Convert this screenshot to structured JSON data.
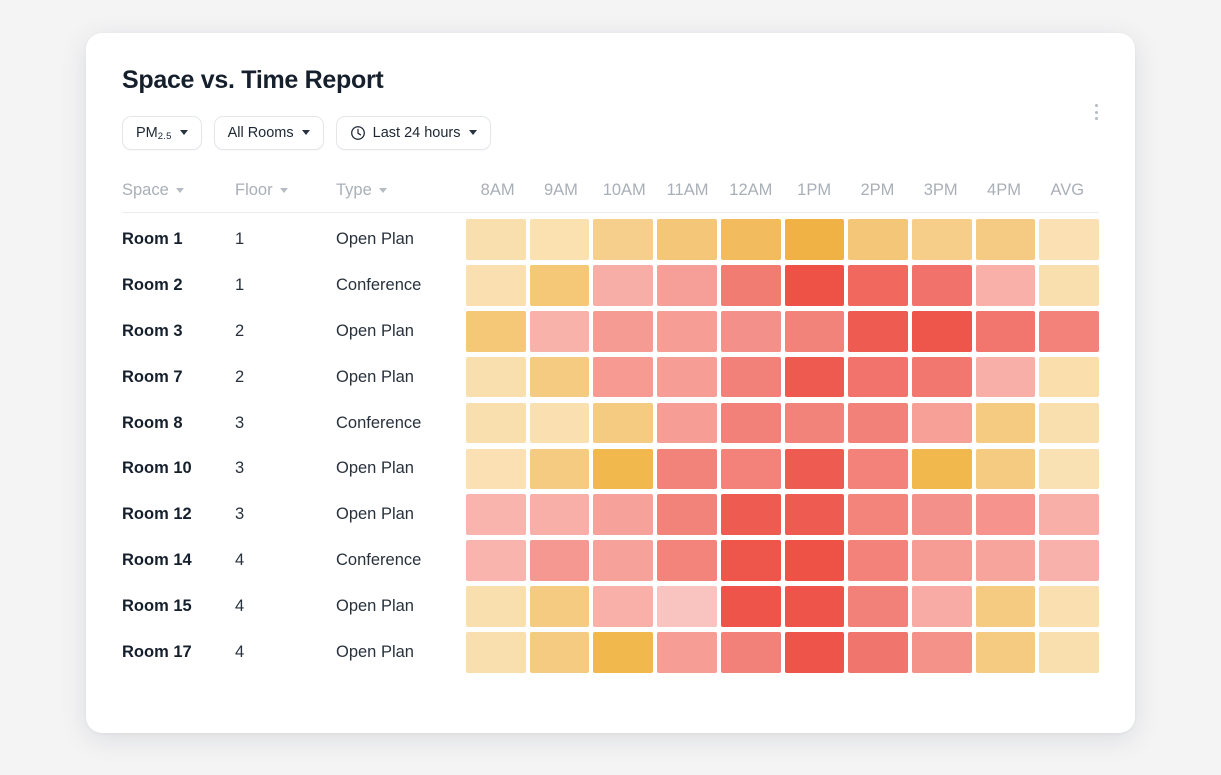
{
  "card": {
    "title": "Space vs. Time Report",
    "menu_icon": "kebab-vertical-icon"
  },
  "filters": [
    {
      "id": "pollutant",
      "label_main": "PM",
      "label_sub": "2.5",
      "caret": true
    },
    {
      "id": "rooms",
      "label_main": "All Rooms",
      "label_sub": "",
      "caret": true
    },
    {
      "id": "timerange",
      "icon": "clock-icon",
      "label_main": "Last 24 hours",
      "label_sub": "",
      "caret": true
    }
  ],
  "table": {
    "columns": [
      {
        "key": "space",
        "label": "Space",
        "sortable": true
      },
      {
        "key": "floor",
        "label": "Floor",
        "sortable": true
      },
      {
        "key": "type",
        "label": "Type",
        "sortable": true
      }
    ],
    "time_headers": [
      "8AM",
      "9AM",
      "10AM",
      "11AM",
      "12AM",
      "1PM",
      "2PM",
      "3PM",
      "4PM",
      "AVG"
    ]
  },
  "chart_data": {
    "type": "heatmap",
    "title": "Space vs. Time Report",
    "xlabel": "",
    "ylabel": "",
    "x_categories": [
      "8AM",
      "9AM",
      "10AM",
      "11AM",
      "12AM",
      "1PM",
      "2PM",
      "3PM",
      "4PM",
      "AVG"
    ],
    "y_categories": [
      "Room 1",
      "Room 2",
      "Room 3",
      "Room 7",
      "Room 8",
      "Room 10",
      "Room 12",
      "Room 14",
      "Room 15",
      "Room 17"
    ],
    "metric": "PM2.5",
    "legend": "none",
    "grid": false,
    "color_scale": {
      "low": "#FADFAE",
      "mid": "#F0B244",
      "high": "#EE5247",
      "stops": [
        "#FADFAE",
        "#F8D79E",
        "#F5CB82",
        "#F2BE63",
        "#F0B244",
        "#F8AFA8",
        "#F59C94",
        "#F4897F",
        "#F07166",
        "#EE5247"
      ]
    },
    "rows": [
      {
        "space": "Room 1",
        "floor": "1",
        "type": "Open Plan",
        "colors": [
          "#FADFAE",
          "#FBE0B0",
          "#F6CF8C",
          "#F4C778",
          "#F2BC5E",
          "#F0B244",
          "#F4C778",
          "#F6CE8A",
          "#F5CB84",
          "#FAE0B2"
        ]
      },
      {
        "space": "Room 2",
        "floor": "1",
        "type": "Conference",
        "colors": [
          "#FAE0B1",
          "#F4C877",
          "#F7AEA7",
          "#F69F99",
          "#F07C72",
          "#EE5247",
          "#F0685E",
          "#F1726A",
          "#F8B0A9",
          "#FADFAE"
        ]
      },
      {
        "space": "Room 3",
        "floor": "2",
        "type": "Open Plan",
        "colors": [
          "#F4C877",
          "#F8B2AA",
          "#F69B93",
          "#F69D95",
          "#F4908A",
          "#F2837B",
          "#EE5B50",
          "#EE564B",
          "#F2766E",
          "#F2827A"
        ]
      },
      {
        "space": "Room 7",
        "floor": "2",
        "type": "Open Plan",
        "colors": [
          "#FADFAE",
          "#F5CB82",
          "#F69A92",
          "#F69E96",
          "#F2817A",
          "#EE5A4F",
          "#F1736B",
          "#F2786F",
          "#F8AFA8",
          "#FADEAC"
        ]
      },
      {
        "space": "Room 8",
        "floor": "3",
        "type": "Conference",
        "colors": [
          "#FADFAE",
          "#FAE0B1",
          "#F5CB82",
          "#F69E96",
          "#F2817A",
          "#F2837B",
          "#F2817A",
          "#F6A098",
          "#F5CB82",
          "#FADFAE"
        ]
      },
      {
        "space": "Room 10",
        "floor": "3",
        "type": "Open Plan",
        "colors": [
          "#FAE0B2",
          "#F5CB82",
          "#F1B84E",
          "#F2837B",
          "#F2827A",
          "#EE5B50",
          "#F2827A",
          "#F1B84E",
          "#F5CB82",
          "#FAE1B4"
        ]
      },
      {
        "space": "Room 12",
        "floor": "3",
        "type": "Open Plan",
        "colors": [
          "#F9B4AD",
          "#F8AFA8",
          "#F6A29A",
          "#F2837B",
          "#EE5B50",
          "#EE5B50",
          "#F2847C",
          "#F3908A",
          "#F5938C",
          "#F8AFA8"
        ]
      },
      {
        "space": "Room 14",
        "floor": "4",
        "type": "Conference",
        "colors": [
          "#F9B4AD",
          "#F59891",
          "#F6A29A",
          "#F2847C",
          "#EE564B",
          "#EE5247",
          "#F2827A",
          "#F69C94",
          "#F6A49C",
          "#F8B2AB"
        ]
      },
      {
        "space": "Room 15",
        "floor": "4",
        "type": "Open Plan",
        "colors": [
          "#FADFAE",
          "#F5CB82",
          "#F8B0A9",
          "#F3888180",
          "#EE5449",
          "#EE5449",
          "#F2817A",
          "#F7ABA4",
          "#F5CB82",
          "#FAE0B1"
        ]
      },
      {
        "space": "Room 17",
        "floor": "4",
        "type": "Open Plan",
        "colors": [
          "#FADFAE",
          "#F5CB82",
          "#F1B84E",
          "#F69E96",
          "#F2817A",
          "#EE5449",
          "#F0756C",
          "#F49189",
          "#F5CB82",
          "#FADFAE"
        ]
      }
    ]
  }
}
